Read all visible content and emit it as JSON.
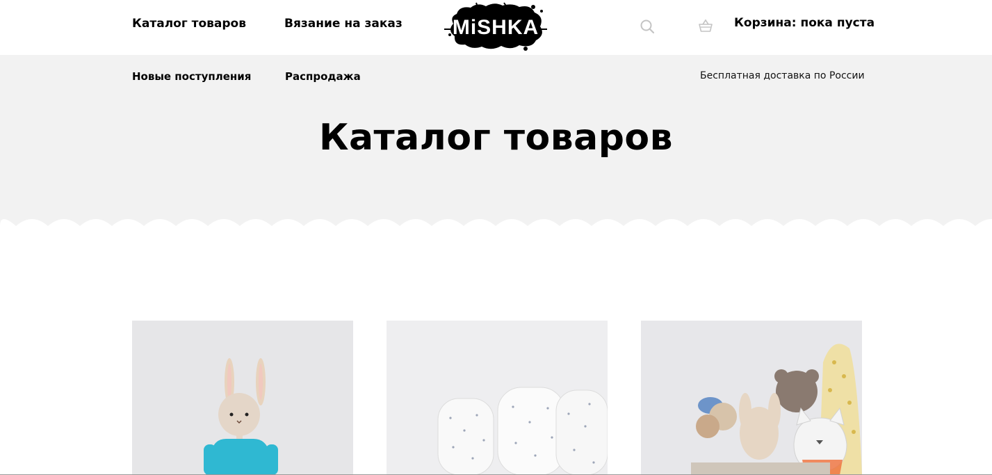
{
  "header": {
    "nav": [
      {
        "label": "Каталог товаров"
      },
      {
        "label": "Вязание на заказ"
      }
    ],
    "logo_text": "MiSHKA",
    "cart_label": "Корзина: пока пуста"
  },
  "subnav": {
    "items": [
      {
        "label": "Новые поступления"
      },
      {
        "label": "Распродажа"
      }
    ],
    "delivery_text": "Бесплатная доставка по России"
  },
  "main": {
    "title": "Каталог товаров"
  },
  "icons": [
    "search-icon",
    "basket-icon"
  ],
  "colors": {
    "hero_bg": "#f2f2f2",
    "text": "#000000",
    "icon_gray": "#c4c4c4"
  }
}
